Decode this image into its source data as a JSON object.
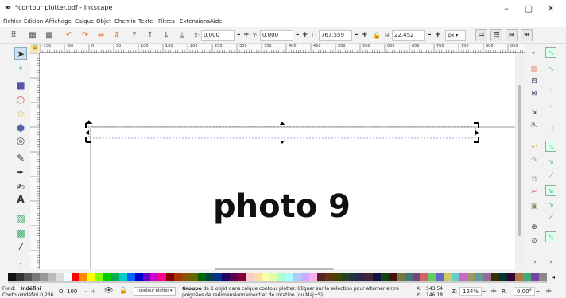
{
  "window": {
    "title": "*contour plotter.pdf - Inkscape",
    "minimize": "–",
    "maximize": "▢",
    "close": "✕"
  },
  "menu": [
    "Fichier",
    "Édition",
    "Affichage",
    "Calque",
    "Objet",
    "Chemin",
    "Texte",
    "Filtres",
    "Extensions",
    "Aide"
  ],
  "controls": {
    "x_label": "X:",
    "x_value": "0,000",
    "y_label": "Y:",
    "y_value": "0,000",
    "w_label": "L:",
    "w_value": "767,559",
    "h_label": "H:",
    "h_value": "22,452",
    "unit": "px",
    "minus": "–",
    "plus": "+",
    "lock": "🔒"
  },
  "ruler": {
    "labels": [
      "-100",
      "-50",
      "0",
      "50",
      "100",
      "150",
      "200",
      "250",
      "300",
      "350",
      "400",
      "450",
      "500",
      "550",
      "600",
      "650",
      "700",
      "750",
      "800",
      "850"
    ]
  },
  "canvas": {
    "text": "photo 9"
  },
  "status": {
    "fill_label": "Fond:",
    "fill_value": "Indéfini",
    "stroke_label": "Contour:",
    "stroke_value": "Indéfini 0,236",
    "opacity_label": "O:",
    "opacity_value": "100",
    "layer": "•contour plotter",
    "message_prefix": "Groupe",
    "message_rest": " de 1 objet dans calque contour plotter. Cliquer sur la sélection pour alterner entre poignées de redimensionnement et de rotation (ou Maj+S).",
    "x_label": "X:",
    "x_value": "543,54",
    "y_label": "Y:",
    "y_value": "146,18",
    "zoom_label": "Z:",
    "zoom_value": "124%",
    "rot_label": "R:",
    "rot_value": "0,00°",
    "minus": "–",
    "plus": "+"
  },
  "palette": [
    "#111111",
    "#333333",
    "#555555",
    "#777777",
    "#999999",
    "#bbbbbb",
    "#dddddd",
    "#ffffff",
    "#ff0000",
    "#ff8800",
    "#ffff00",
    "#88ff00",
    "#00cc00",
    "#00aa55",
    "#00cccc",
    "#0066ff",
    "#0000cc",
    "#6600cc",
    "#cc00cc",
    "#ff0088",
    "#800000",
    "#aa3300",
    "#885500",
    "#666600",
    "#006600",
    "#004444",
    "#003388",
    "#220066",
    "#550055",
    "#880033",
    "#ffcccc",
    "#ffddaa",
    "#ffffaa",
    "#ddffaa",
    "#aaffcc",
    "#aaffff",
    "#aaccff",
    "#ccaaff",
    "#ffaaee",
    "#552222",
    "#663311",
    "#444400",
    "#224422",
    "#223344",
    "#332244",
    "#442233",
    "#111144",
    "#114411",
    "#441111",
    "#777744",
    "#447777",
    "#774477",
    "#cc6666",
    "#66cc66",
    "#6666cc",
    "#cccc66",
    "#66cccc",
    "#cc66cc",
    "#999966",
    "#669999",
    "#996699",
    "#333300",
    "#003333",
    "#330033",
    "#aa7744",
    "#44aa77",
    "#7744aa",
    "#888888"
  ]
}
